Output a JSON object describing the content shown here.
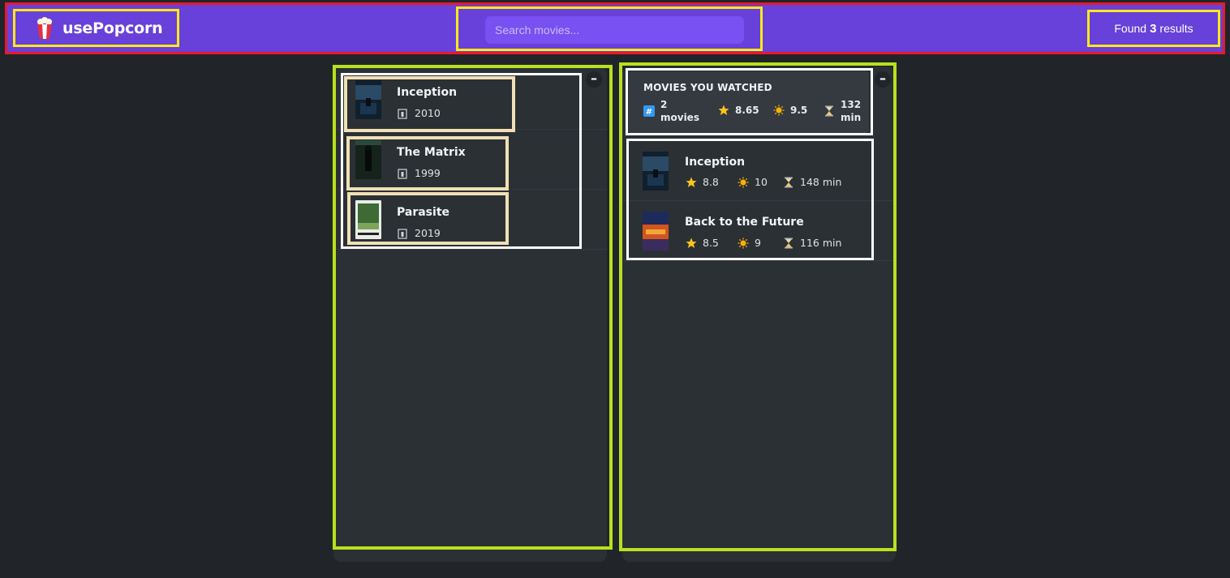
{
  "nav": {
    "logo_text": "usePopcorn",
    "logo_icon": "popcorn-icon",
    "search_placeholder": "Search movies...",
    "results_prefix": "Found",
    "results_count": "3",
    "results_suffix": "results"
  },
  "list_box": {
    "toggle_label": "–",
    "movies": [
      {
        "title": "Inception",
        "year": "2010",
        "poster": "inception"
      },
      {
        "title": "The Matrix",
        "year": "1999",
        "poster": "matrix"
      },
      {
        "title": "Parasite",
        "year": "2019",
        "poster": "parasite"
      }
    ]
  },
  "watched_box": {
    "toggle_label": "–",
    "summary": {
      "heading": "Movies you watched",
      "count_number": "2",
      "count_word": "movies",
      "imdb_avg": "8.65",
      "user_avg": "9.5",
      "runtime_number": "132",
      "runtime_unit": "min"
    },
    "movies": [
      {
        "title": "Inception",
        "imdb": "8.8",
        "user": "10",
        "runtime": "148 min",
        "poster": "inception"
      },
      {
        "title": "Back to the Future",
        "imdb": "8.5",
        "user": "9",
        "runtime": "116 min",
        "poster": "bttf"
      }
    ]
  },
  "colors": {
    "nav_bg": "#6741d9",
    "search_bg": "#7950f2",
    "panel_bg": "#2b3035",
    "page_bg": "#212529"
  }
}
